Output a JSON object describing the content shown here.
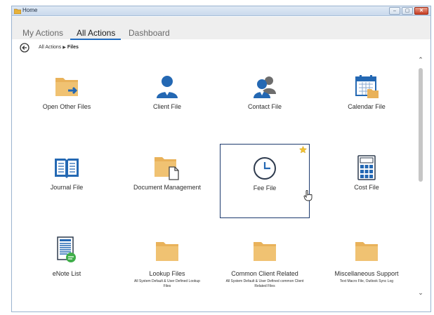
{
  "window": {
    "title": "Home"
  },
  "tabs": [
    {
      "label": "My Actions"
    },
    {
      "label": "All Actions"
    },
    {
      "label": "Dashboard"
    }
  ],
  "active_tab": "All Actions",
  "breadcrumb": {
    "parent": "All Actions",
    "current": "Files"
  },
  "tiles": [
    {
      "label": "Open Other Files",
      "icon": "folder-arrow-icon"
    },
    {
      "label": "Client File",
      "icon": "person-icon"
    },
    {
      "label": "Contact File",
      "icon": "contacts-icon"
    },
    {
      "label": "Calendar File",
      "icon": "calendar-icon"
    },
    {
      "label": "Journal File",
      "icon": "book-icon"
    },
    {
      "label": "Document Management",
      "icon": "folder-document-icon"
    },
    {
      "label": "Fee File",
      "icon": "clock-icon",
      "selected": true,
      "favorite": true
    },
    {
      "label": "Cost File",
      "icon": "calculator-icon"
    },
    {
      "label": "eNote List",
      "icon": "enote-icon"
    },
    {
      "label": "Lookup Files",
      "icon": "folder-icon",
      "sublabel": "All System Default & User Defined Lookup Files"
    },
    {
      "label": "Common Client Related",
      "icon": "folder-icon",
      "sublabel": "All System Default & User Defined common Client Related Files"
    },
    {
      "label": "Miscellaneous Support",
      "icon": "folder-icon",
      "sublabel": "Text Macro File, Outlook Sync Log"
    }
  ],
  "colors": {
    "accent": "#1f6bbf",
    "folder": "#e9b25a",
    "icon_blue": "#2468b3",
    "selected_border": "#1d3a6e",
    "star": "#f2c232"
  }
}
